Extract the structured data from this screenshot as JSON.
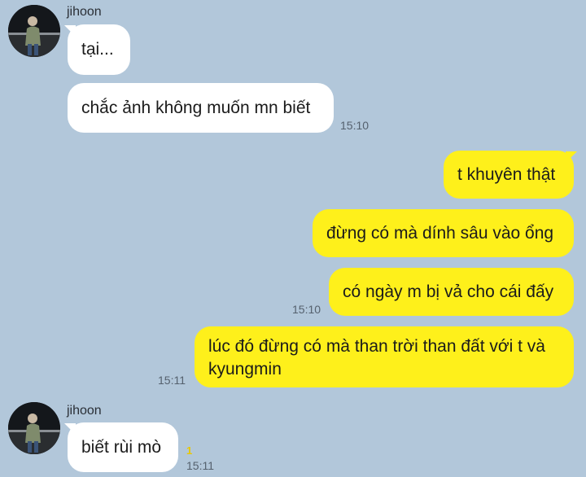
{
  "messages": {
    "group1": {
      "sender": "jihoon",
      "items": [
        {
          "text": "tại..."
        },
        {
          "text": "chắc ảnh không muốn mn biết",
          "time": "15:10"
        }
      ]
    },
    "group2": {
      "items": [
        {
          "text": "t khuyên thật"
        },
        {
          "text": "đừng có mà dính sâu vào ổng"
        },
        {
          "text": "có ngày m bị vả cho cái đấy",
          "time": "15:10"
        },
        {
          "text": "lúc đó đừng có mà than trời than đất với t và kyungmin",
          "time": "15:11"
        }
      ]
    },
    "group3": {
      "sender": "jihoon",
      "items": [
        {
          "text": "biết rùi mò",
          "unread": "1",
          "time": "15:11"
        }
      ]
    }
  },
  "colors": {
    "background": "#b2c7da",
    "incoming_bubble": "#ffffff",
    "outgoing_bubble": "#fef01b",
    "unread": "#e9c800"
  },
  "icons": {
    "avatar": "profile-photo"
  }
}
